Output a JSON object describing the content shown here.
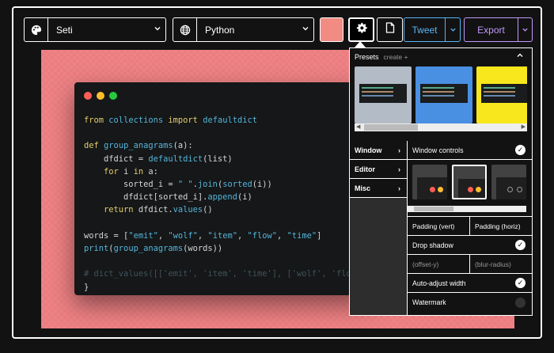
{
  "toolbar": {
    "theme": {
      "icon": "palette-icon",
      "value": "Seti"
    },
    "language": {
      "icon": "globe-icon",
      "value": "Python"
    },
    "background_color": "#f28b82",
    "tweet_label": "Tweet",
    "export_label": "Export"
  },
  "code_window": {
    "controls_colors": [
      "#ff5f56",
      "#ffbd2e",
      "#27c93f"
    ],
    "lines": [
      "from collections import defaultdict",
      "",
      "def group_anagrams(a):",
      "    dfdict = defaultdict(list)",
      "    for i in a:",
      "        sorted_i = \" \".join(sorted(i))",
      "        dfdict[sorted_i].append(i)",
      "    return dfdict.values()",
      "",
      "words = [\"emit\", \"wolf\", \"item\", \"flow\", \"time\"]",
      "print(group_anagrams(words))",
      "",
      "# dict_values([['emit', 'item', 'time'], ['wolf', 'flo",
      "}"
    ]
  },
  "settings": {
    "presets_title": "Presets",
    "presets_create": "create +",
    "preset_colors": [
      "#b3bcc6",
      "#4a90e2",
      "#f8e71c"
    ],
    "tabs": [
      "Window",
      "Editor",
      "Misc"
    ],
    "window_controls_label": "Window controls",
    "padding_vert": "Padding (vert)",
    "padding_horiz": "Padding (horiz)",
    "drop_shadow_label": "Drop shadow",
    "offset_y_placeholder": "(offset-y)",
    "blur_radius_placeholder": "(blur-radius)",
    "auto_adjust_label": "Auto-adjust width",
    "watermark_label": "Watermark"
  }
}
